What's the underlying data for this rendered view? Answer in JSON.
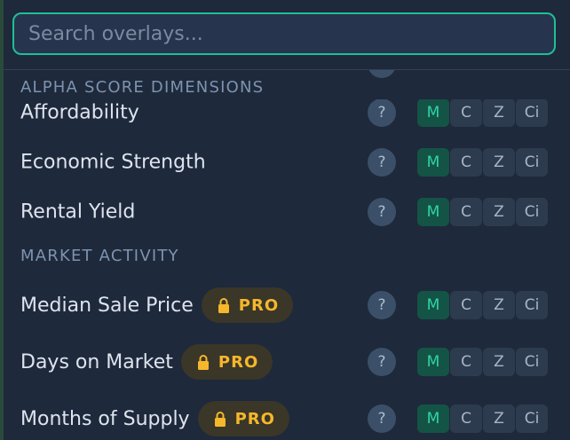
{
  "search": {
    "placeholder": "Search overlays..."
  },
  "help_glyph": "?",
  "toggles": [
    "M",
    "C",
    "Z",
    "Ci"
  ],
  "active_toggle": "M",
  "sections": [
    {
      "header": "ALPHA SCORE DIMENSIONS",
      "items": [
        {
          "label": "Affordability",
          "pro": false
        },
        {
          "label": "Economic Strength",
          "pro": false
        },
        {
          "label": "Rental Yield",
          "pro": false
        }
      ]
    },
    {
      "header": "MARKET ACTIVITY",
      "items": [
        {
          "label": "Median Sale Price",
          "pro": true
        },
        {
          "label": "Days on Market",
          "pro": true
        },
        {
          "label": "Months of Supply",
          "pro": true
        }
      ]
    }
  ],
  "pro_label": "PRO",
  "colors": {
    "accent": "#1fbf96",
    "active_toggle_bg": "#145446",
    "pro_text": "#f5b72c",
    "panel_bg": "#1e293b"
  }
}
